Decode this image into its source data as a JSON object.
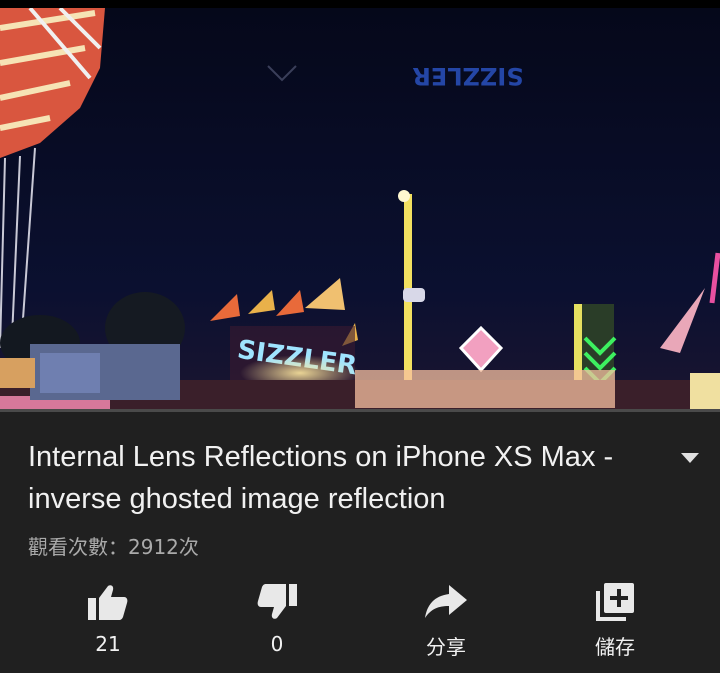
{
  "video": {
    "sign_text": "SIZZLER",
    "ghost_text": "SIZZLER",
    "progress_fraction": 0.0
  },
  "title": "Internal Lens Reflections on iPhone XS Max - inverse ghosted image reflection",
  "views_label": "觀看次數：2912次",
  "actions": {
    "like": {
      "icon": "thumbs-up-icon",
      "label": "21"
    },
    "dislike": {
      "icon": "thumbs-down-icon",
      "label": "0"
    },
    "share": {
      "icon": "share-arrow-icon",
      "label": "分享"
    },
    "save": {
      "icon": "add-to-playlist-icon",
      "label": "儲存"
    }
  },
  "colors": {
    "background": "#202020",
    "text": "#f1f1f1",
    "secondary_text": "#aaaaaa",
    "progress": "#ff0000"
  }
}
